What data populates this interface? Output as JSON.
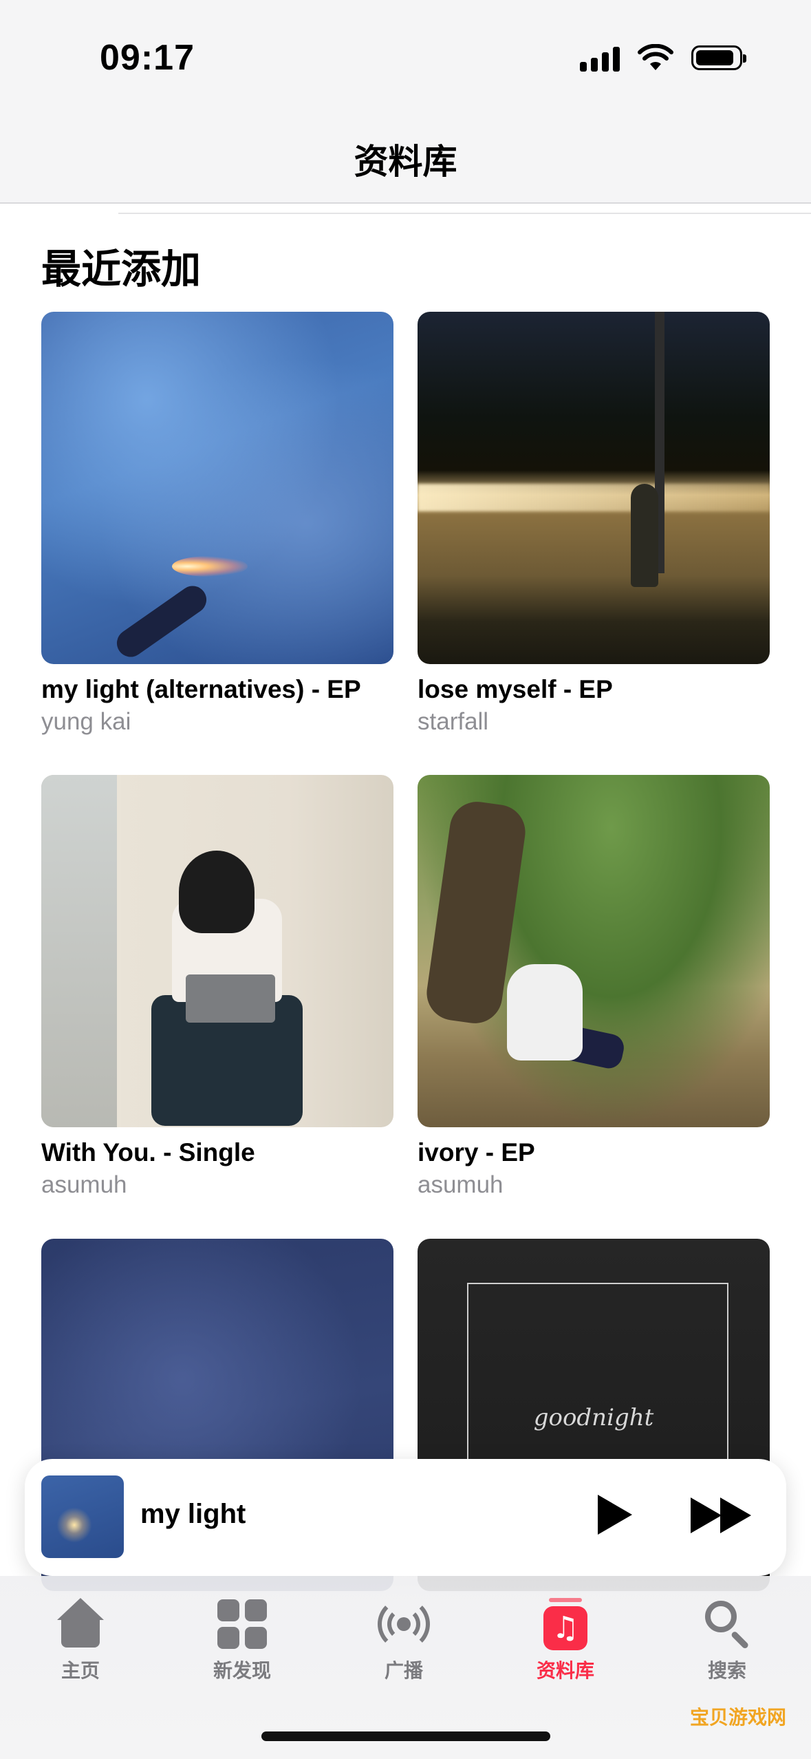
{
  "status_bar": {
    "time": "09:17"
  },
  "nav": {
    "title": "资料库"
  },
  "section": {
    "title": "最近添加"
  },
  "albums": [
    {
      "title": "my light (alternatives) - EP",
      "artist": "yung kai"
    },
    {
      "title": "lose myself - EP",
      "artist": "starfall"
    },
    {
      "title": "With You. - Single",
      "artist": "asumuh"
    },
    {
      "title": "ivory - EP",
      "artist": "asumuh"
    },
    {
      "title": "",
      "artist": ""
    },
    {
      "title": "",
      "artist": "",
      "cover_text": "goodnight"
    }
  ],
  "mini_player": {
    "title": "my light"
  },
  "tabs": [
    {
      "label": "主页",
      "icon": "house-icon"
    },
    {
      "label": "新发现",
      "icon": "grid-icon"
    },
    {
      "label": "广播",
      "icon": "radio-icon"
    },
    {
      "label": "资料库",
      "icon": "library-icon",
      "active": true
    },
    {
      "label": "搜索",
      "icon": "search-icon"
    }
  ],
  "colors": {
    "accent": "#fa2d48",
    "secondary_text": "#8e8e93"
  },
  "watermark": "宝贝游戏网"
}
